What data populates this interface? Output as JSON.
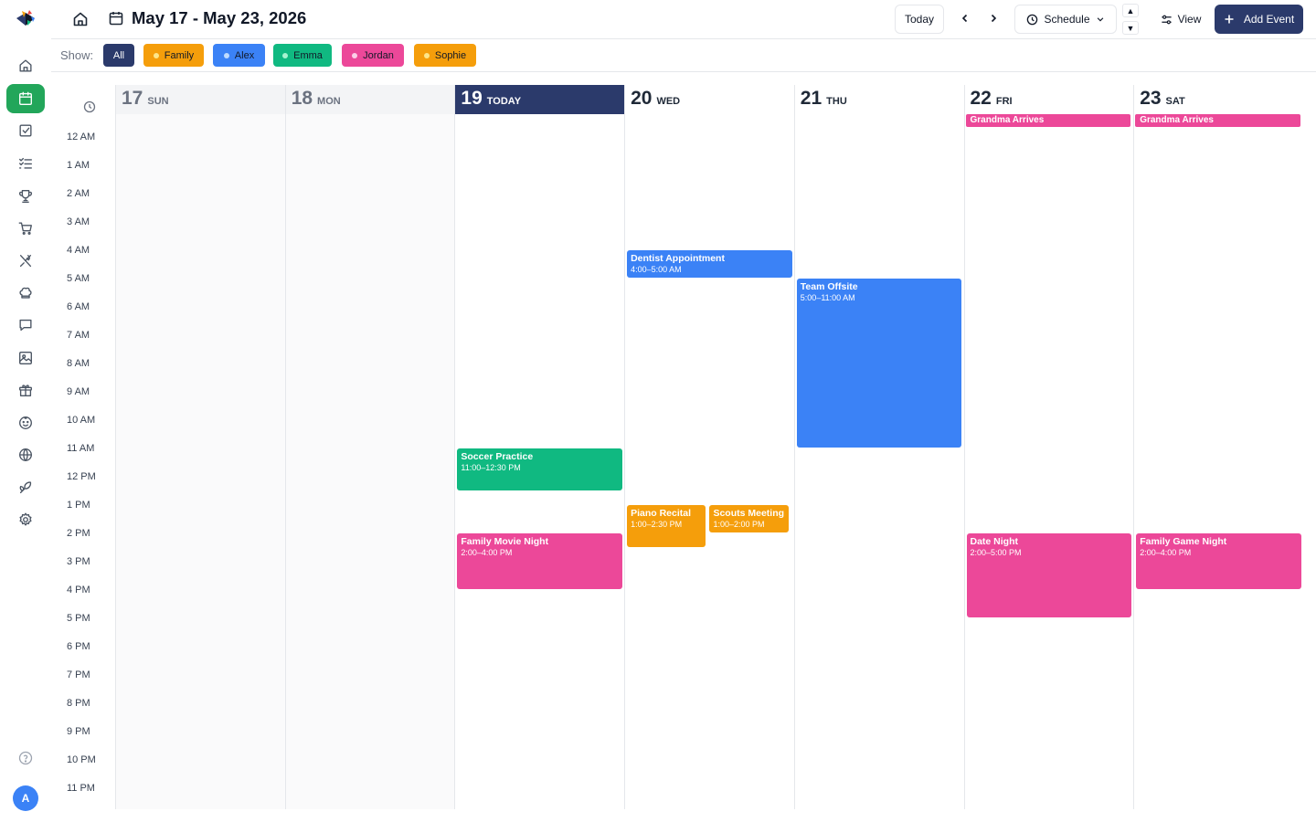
{
  "sidebar": {
    "items": [
      {
        "name": "home",
        "icon": "home-icon"
      },
      {
        "name": "calendar",
        "icon": "calendar-icon",
        "active": true
      },
      {
        "name": "tasks",
        "icon": "checkbox-icon"
      },
      {
        "name": "lists",
        "icon": "checklist-icon"
      },
      {
        "name": "rewards",
        "icon": "trophy-icon"
      },
      {
        "name": "shopping",
        "icon": "cart-icon"
      },
      {
        "name": "meals",
        "icon": "utensils-icon"
      },
      {
        "name": "recipes",
        "icon": "chef-hat-icon"
      },
      {
        "name": "messages",
        "icon": "message-icon"
      },
      {
        "name": "photos",
        "icon": "image-icon"
      },
      {
        "name": "gifts",
        "icon": "gift-icon"
      },
      {
        "name": "kids",
        "icon": "baby-face-icon"
      },
      {
        "name": "web",
        "icon": "globe-icon"
      },
      {
        "name": "plants",
        "icon": "plant-icon"
      },
      {
        "name": "settings",
        "icon": "gear-icon"
      }
    ],
    "help_icon": "help-icon",
    "avatar_initial": "A"
  },
  "header": {
    "title": "May 17 - May 23, 2026",
    "today_label": "Today",
    "schedule_label": "Schedule",
    "view_label": "View",
    "add_event_label": "Add Event"
  },
  "filter": {
    "show_label": "Show:",
    "chips": [
      {
        "label": "All",
        "bg": "#2b3a6b",
        "color": "#ffffff",
        "dot": null,
        "active": true
      },
      {
        "label": "Family",
        "bg": "#f59e0b",
        "color": "#111827",
        "dot": "#fde68a"
      },
      {
        "label": "Alex",
        "bg": "#3b82f6",
        "color": "#111827",
        "dot": "#bfdbfe"
      },
      {
        "label": "Emma",
        "bg": "#10b981",
        "color": "#111827",
        "dot": "#a7f3d0"
      },
      {
        "label": "Jordan",
        "bg": "#ec4899",
        "color": "#111827",
        "dot": "#fbcfe8"
      },
      {
        "label": "Sophie",
        "bg": "#f59e0b",
        "color": "#111827",
        "dot": "#fde68a"
      }
    ]
  },
  "calendar": {
    "hours": [
      "12 AM",
      "1 AM",
      "2 AM",
      "3 AM",
      "4 AM",
      "5 AM",
      "6 AM",
      "7 AM",
      "8 AM",
      "9 AM",
      "10 AM",
      "11 AM",
      "12 PM",
      "1 PM",
      "2 PM",
      "3 PM",
      "4 PM",
      "5 PM",
      "6 PM",
      "7 PM",
      "8 PM",
      "9 PM",
      "10 PM",
      "11 PM"
    ],
    "days": [
      {
        "num": "17",
        "name": "SUN",
        "state": "past"
      },
      {
        "num": "18",
        "name": "MON",
        "state": "past"
      },
      {
        "num": "19",
        "name": "TODAY",
        "state": "today"
      },
      {
        "num": "20",
        "name": "WED",
        "state": "future"
      },
      {
        "num": "21",
        "name": "THU",
        "state": "future"
      },
      {
        "num": "22",
        "name": "FRI",
        "state": "future"
      },
      {
        "num": "23",
        "name": "SAT",
        "state": "future"
      }
    ],
    "all_day_events": [
      {
        "day": 5,
        "title": "Grandma Arrives",
        "color": "#ec4899"
      },
      {
        "day": 6,
        "title": "Grandma Arrives",
        "color": "#ec4899"
      }
    ],
    "events": [
      {
        "day": 3,
        "start": 4,
        "end": 5,
        "title": "Dentist Appointment",
        "time": "4:00–5:00 AM",
        "color": "#3b82f6",
        "lane": 0,
        "lanes": 1
      },
      {
        "day": 4,
        "start": 5,
        "end": 11,
        "title": "Team Offsite",
        "time": "5:00–11:00 AM",
        "color": "#3b82f6",
        "lane": 0,
        "lanes": 1
      },
      {
        "day": 2,
        "start": 11,
        "end": 12.5,
        "title": "Soccer Practice",
        "time": "11:00–12:30 PM",
        "color": "#10b981",
        "lane": 0,
        "lanes": 1
      },
      {
        "day": 3,
        "start": 13,
        "end": 14.5,
        "title": "Piano Recital",
        "time": "1:00–2:30 PM",
        "color": "#f59e0b",
        "lane": 0,
        "lanes": 2
      },
      {
        "day": 3,
        "start": 13,
        "end": 14,
        "title": "Scouts Meeting",
        "time": "1:00–2:00 PM",
        "color": "#f59e0b",
        "lane": 1,
        "lanes": 2
      },
      {
        "day": 2,
        "start": 14,
        "end": 16,
        "title": "Family Movie Night",
        "time": "2:00–4:00 PM",
        "color": "#ec4899",
        "lane": 0,
        "lanes": 1
      },
      {
        "day": 5,
        "start": 14,
        "end": 17,
        "title": "Date Night",
        "time": "2:00–5:00 PM",
        "color": "#ec4899",
        "lane": 0,
        "lanes": 1
      },
      {
        "day": 6,
        "start": 14,
        "end": 16,
        "title": "Family Game Night",
        "time": "2:00–4:00 PM",
        "color": "#ec4899",
        "lane": 0,
        "lanes": 1
      }
    ]
  }
}
